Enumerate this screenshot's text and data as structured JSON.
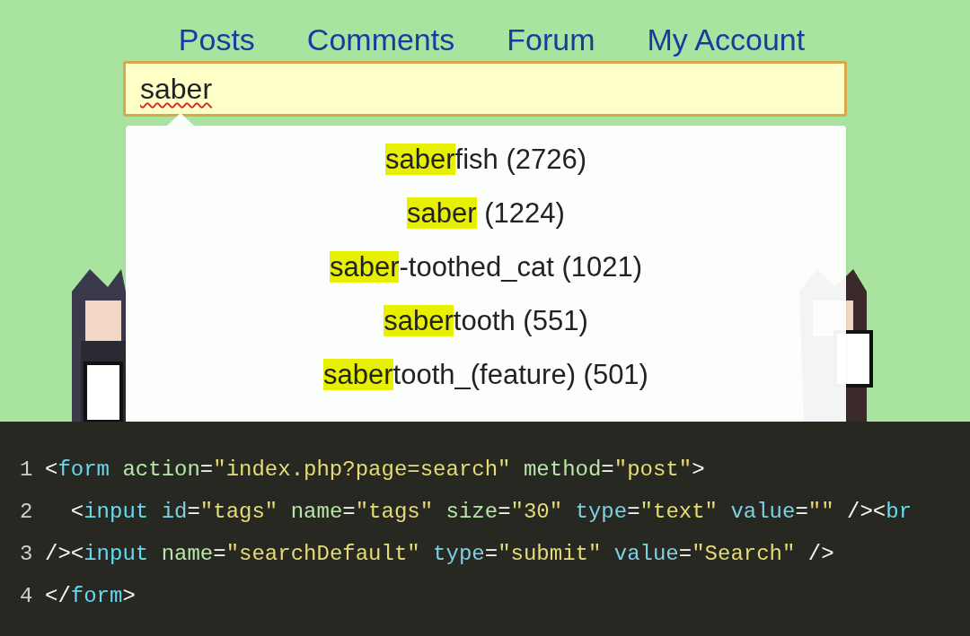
{
  "nav": [
    {
      "label": "Posts"
    },
    {
      "label": "Comments"
    },
    {
      "label": "Forum"
    },
    {
      "label": "My Account"
    }
  ],
  "search": {
    "value": "saber",
    "spellcheck_error": true
  },
  "suggestions": [
    {
      "match": "saber",
      "rest": "fish",
      "count": "(2726)"
    },
    {
      "match": "saber",
      "count": "(1224)"
    },
    {
      "match": "saber",
      "rest": "-toothed_cat",
      "count": "(1021)"
    },
    {
      "match": "saber",
      "rest": "tooth",
      "count": "(551)"
    },
    {
      "match": "saber",
      "rest": "tooth_(feature)",
      "count": "(501)"
    }
  ],
  "code": [
    {
      "number": "1",
      "tokens": [
        {
          "kind": "punct",
          "text": "<"
        },
        {
          "kind": "tag",
          "text": "form"
        },
        {
          "kind": "attr",
          "text": " action"
        },
        {
          "kind": "punct",
          "text": "="
        },
        {
          "kind": "string",
          "text": "\"index.php?page=search\""
        },
        {
          "kind": "attr",
          "text": " method"
        },
        {
          "kind": "punct",
          "text": "="
        },
        {
          "kind": "string",
          "text": "\"post\""
        },
        {
          "kind": "punct",
          "text": ">"
        }
      ]
    },
    {
      "number": "2",
      "tokens": [
        {
          "kind": "punct",
          "text": "  <"
        },
        {
          "kind": "tag",
          "text": "input"
        },
        {
          "kind": "attr2",
          "text": " id"
        },
        {
          "kind": "punct",
          "text": "="
        },
        {
          "kind": "string",
          "text": "\"tags\""
        },
        {
          "kind": "attr",
          "text": " name"
        },
        {
          "kind": "punct",
          "text": "="
        },
        {
          "kind": "string",
          "text": "\"tags\""
        },
        {
          "kind": "attr",
          "text": " size"
        },
        {
          "kind": "punct",
          "text": "="
        },
        {
          "kind": "string",
          "text": "\"30\""
        },
        {
          "kind": "attr2",
          "text": " type"
        },
        {
          "kind": "punct",
          "text": "="
        },
        {
          "kind": "string",
          "text": "\"text\""
        },
        {
          "kind": "attr2",
          "text": " value"
        },
        {
          "kind": "punct",
          "text": "="
        },
        {
          "kind": "string",
          "text": "\"\""
        },
        {
          "kind": "punct",
          "text": " /><"
        },
        {
          "kind": "tag",
          "text": "br"
        }
      ]
    },
    {
      "number": "3",
      "tokens": [
        {
          "kind": "punct",
          "text": "/><"
        },
        {
          "kind": "tag",
          "text": "input"
        },
        {
          "kind": "attr",
          "text": " name"
        },
        {
          "kind": "punct",
          "text": "="
        },
        {
          "kind": "string",
          "text": "\"searchDefault\""
        },
        {
          "kind": "attr2",
          "text": " type"
        },
        {
          "kind": "punct",
          "text": "="
        },
        {
          "kind": "string",
          "text": "\"submit\""
        },
        {
          "kind": "attr2",
          "text": " value"
        },
        {
          "kind": "punct",
          "text": "="
        },
        {
          "kind": "string",
          "text": "\"Search\""
        },
        {
          "kind": "punct",
          "text": " />"
        }
      ]
    },
    {
      "number": "4",
      "tokens": [
        {
          "kind": "punct",
          "text": "</"
        },
        {
          "kind": "tag",
          "text": "form"
        },
        {
          "kind": "punct",
          "text": ">"
        }
      ]
    }
  ]
}
